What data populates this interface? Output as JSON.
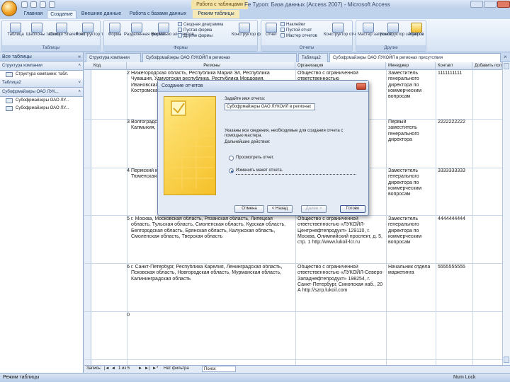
{
  "window": {
    "title": "Fe Туроп: База данных (Access 2007) - Microsoft Access",
    "context_tab": "Работа с таблицами"
  },
  "ribbon": {
    "tabs": [
      "Главная",
      "Создание",
      "Внешние данные",
      "Работа с базами данных",
      "Режим таблицы"
    ],
    "active_tab": "Создание",
    "groups": [
      {
        "title": "Таблицы",
        "buttons": [
          "Таблица",
          "Шаблоны таблиц",
          "Списки SharePoint",
          "Конструктор таблиц"
        ]
      },
      {
        "title": "Формы",
        "buttons": [
          "Форма",
          "Разделенная форма",
          "Несколько элементов"
        ],
        "small": [
          "Сводная диаграмма",
          "Пустая форма",
          "Другие формы"
        ],
        "extra": "Конструктор форм"
      },
      {
        "title": "Отчеты",
        "buttons": [
          "Отчет"
        ],
        "small": [
          "Наклейки",
          "Пустой отчет",
          "Мастер отчетов"
        ],
        "extra": "Конструктор отчетов"
      },
      {
        "title": "Другие",
        "buttons": [
          "Мастер запросов",
          "Конструктор запросов",
          "Макрос"
        ]
      }
    ]
  },
  "nav": {
    "header": "Все таблицы",
    "sections": [
      {
        "title": "Структура компании",
        "items": [
          "Структура компании: табл."
        ]
      },
      {
        "title": "Таблица2",
        "items": []
      },
      {
        "title": "Субофрмайзеры ОАО ЛУК...",
        "items": [
          "Субофрмайзеры ОАО ЛУ...",
          "Субофрмайзеры ОАО ЛУ..."
        ]
      }
    ]
  },
  "doc_tabs": [
    "Структура компании",
    "Субофрмайзеры ОАО ЛУКОЙЛ в регионах",
    "Таблица2",
    "Субофрмайзеры ОАО ЛУКОЙЛ в регионах присутствия"
  ],
  "grid": {
    "columns": [
      "Код",
      "Регионы",
      "Организация",
      "Менеджер",
      "Контакт",
      "Добавить поле"
    ],
    "rows": [
      {
        "id": "2",
        "region": "Нижегородская область, Республика Марий Эл, Республика Чувашия, Удмуртская республика, Республика Мордовия, Ивановская область, Кировская область, Пермский край, Костромская",
        "org": "Общество с ограниченной ответственностью",
        "manager": "Заместитель генерального директора по коммерческим вопросам",
        "phone": "1111111111"
      },
      {
        "id": "3",
        "region": "Волгоградская область, Астраханская область, Республика Калмыкия, Саратовская",
        "org": "",
        "manager": "Первый заместитель генерального директора",
        "phone": "2222222222"
      },
      {
        "id": "4",
        "region": "Пермский край, Свердловская область, Челябинская область, Тюменская область, Томская область, Омская область",
        "org": "",
        "manager": "Заместитель генерального директора по коммерческим вопросам",
        "phone": "3333333333"
      },
      {
        "id": "5",
        "region": "г. Москва, Московская область, Рязанская область, Липецкая область, Тульская область, Смоленская область, Курская область, Белгородская область, Брянская область, Калужская область, Смоленская область, Тверская область",
        "org": "Общество с ограниченной ответственностью «ЛУКОЙЛ-Центрнефтепродукт» 129110, г. Москва, Олимпийский проспект, д. 5, стр. 1 http://www.lukoil-lcr.ru",
        "manager": "Заместитель генерального директора по коммерческим вопросам",
        "phone": "4444444444"
      },
      {
        "id": "6",
        "region": "г. Санкт-Петербург, Республика Карелия, Ленинградская область, Псковская область, Новгородская область, Мурманская область, Калининградская область",
        "org": "Общество с ограниченной ответственностью «ЛУКОЙЛ-Северо-Западнефтепродукт» 198254, г. Санкт-Петербург, Синопская наб., 20 А http://szrp.lukoil.com",
        "manager": "Начальник отдела маркетинга",
        "phone": "5555555555"
      },
      {
        "id": "0",
        "region": "",
        "org": "",
        "manager": "",
        "phone": ""
      }
    ]
  },
  "record_nav": {
    "label": "Запись:",
    "position": "1 из 5",
    "filter": "Нет фильтра",
    "search": "Поиск"
  },
  "status": {
    "left": "Режим таблицы",
    "right": "Num Lock"
  },
  "dialog": {
    "title": "Создание отчетов",
    "prompt": "Задайте имя отчета:",
    "report_name": "Субофрмайзеры ОАО ЛУКОЙЛ в регионах",
    "info": "Указаны все сведения, необходимые для создания отчета с помощью мастера.",
    "next_action": "Дальнейшие действия:",
    "options": [
      "Просмотреть отчет.",
      "Изменить макет отчета."
    ],
    "selected_option": 1,
    "buttons": {
      "cancel": "Отмена",
      "back": "< Назад",
      "next": "Далее >",
      "finish": "Готово"
    }
  }
}
